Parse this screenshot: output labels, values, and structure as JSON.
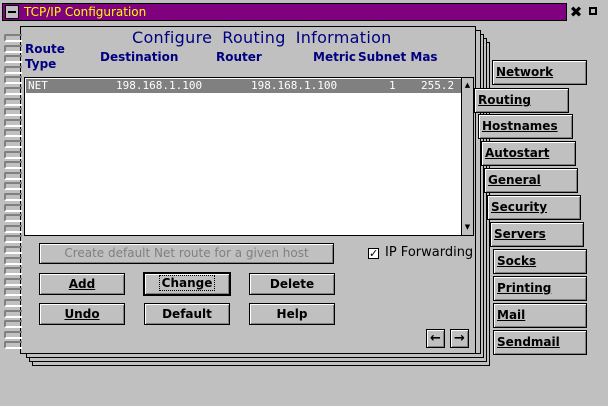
{
  "window": {
    "title": "TCP/IP Configuration",
    "system_menu_icon": "minus-icon",
    "close_icon": "close-icon",
    "maximize_icon": "maximize-icon"
  },
  "page": {
    "heading": [
      "Configure",
      "Routing",
      "Information"
    ],
    "columns": {
      "route_type": "Route Type",
      "route_type_line1": "Route",
      "route_type_line2": "Type",
      "destination": "Destination",
      "router": "Router",
      "metric": "Metric",
      "subnet_mask": "Subnet Mas"
    },
    "routes": [
      {
        "type": "NET",
        "destination": "198.168.1.100",
        "router": "198.168.1.100",
        "metric": "1",
        "subnet_mask": "255.2"
      }
    ],
    "create_default_button": "Create default Net route for a given host",
    "ip_forwarding": {
      "label": "IP Forwarding",
      "checked": true,
      "mark": "✓"
    },
    "buttons": {
      "add": "Add",
      "change": "Change",
      "delete": "Delete",
      "undo": "Undo",
      "default": "Default",
      "help": "Help"
    },
    "nav": {
      "prev": "🡐",
      "next": "🡒",
      "prev_icon": "arrow-left-icon",
      "next_icon": "arrow-right-icon"
    }
  },
  "tabs": [
    {
      "label": "Network",
      "active": false
    },
    {
      "label": "Routing",
      "active": true
    },
    {
      "label": "Hostnames",
      "active": false
    },
    {
      "label": "Autostart",
      "active": false
    },
    {
      "label": "General",
      "active": false
    },
    {
      "label": "Security",
      "active": false
    },
    {
      "label": "Servers",
      "active": false
    },
    {
      "label": "Socks",
      "active": false
    },
    {
      "label": "Printing",
      "active": false
    },
    {
      "label": "Mail",
      "active": false
    },
    {
      "label": "Sendmail",
      "active": false
    }
  ],
  "colors": {
    "titlebar": "#800080",
    "title_text": "#ffff00",
    "heading_text": "#000080",
    "selected_row": "#808080",
    "face": "#c0c0c0"
  }
}
